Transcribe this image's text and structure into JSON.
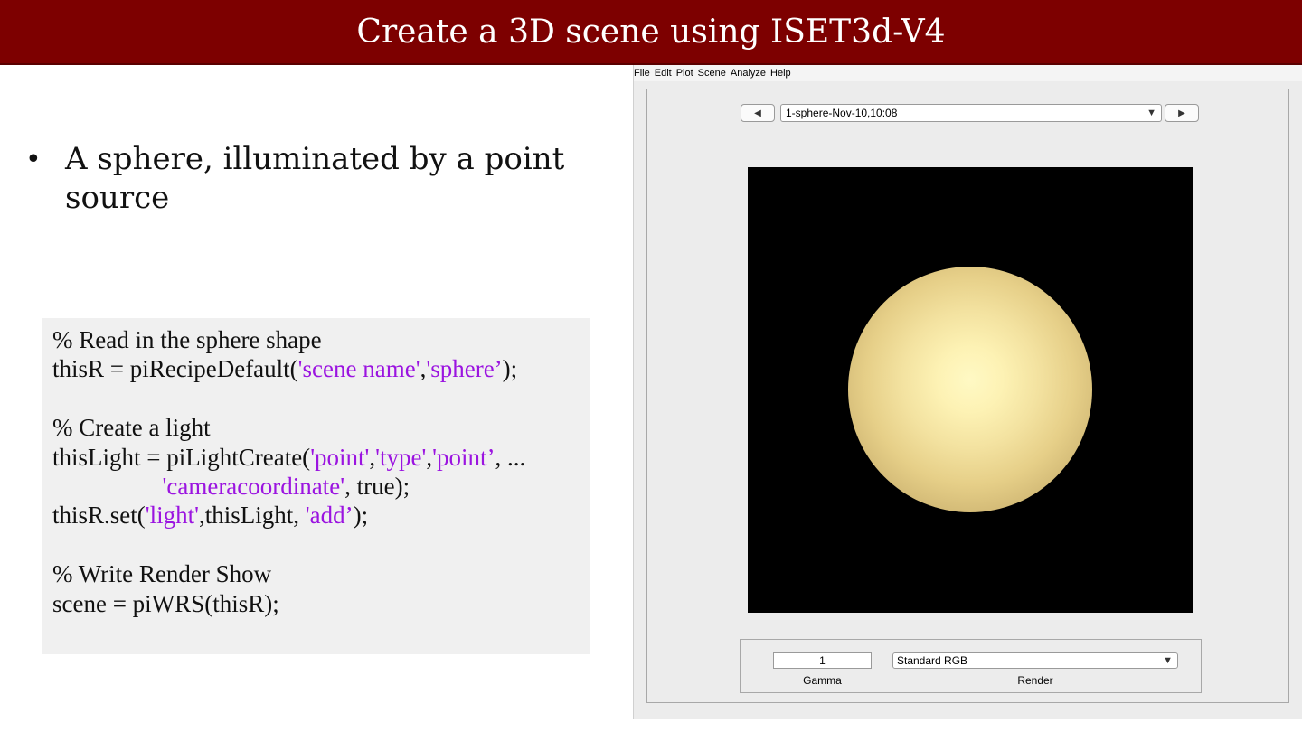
{
  "slide": {
    "title": "Create a 3D scene using ISET3d-V4",
    "bullet_symbol": "•",
    "bullet_line1": "A sphere, illuminated by a point",
    "bullet_line2": "source"
  },
  "code": {
    "l1": "% Read in the sphere shape",
    "l2a": "thisR = piRecipeDefault(",
    "l2b": "'scene name'",
    "l2c": ",",
    "l2d": "'sphere’",
    "l2e": ");",
    "l3": "% Create a light",
    "l4a": "thisLight = piLightCreate(",
    "l4b": "'point'",
    "l4c": ",",
    "l4d": "'type'",
    "l4e": ",",
    "l4f": "'point’",
    "l4g": ", ...",
    "l5a": "                  ",
    "l5b": "'cameracoordinate'",
    "l5c": ", true);",
    "l6a": "thisR.set(",
    "l6b": "'light'",
    "l6c": ",thisLight, ",
    "l6d": "'add’",
    "l6e": ");",
    "l7": "% Write Render Show",
    "l8": "scene = piWRS(thisR);"
  },
  "figure": {
    "menu": [
      "File",
      "Edit",
      "Plot",
      "Scene",
      "Analyze",
      "Help"
    ],
    "prev_icon": "◀",
    "next_icon": "▶",
    "scene_selected": "1-sphere-Nov-10,10:08",
    "dropdown_icon": "▼",
    "gamma_value": "1",
    "gamma_label": "Gamma",
    "render_selected": "Standard RGB",
    "render_label": "Render"
  },
  "colors": {
    "title_bar": "#7d0000",
    "string_literal": "#9b14e0",
    "code_background": "#f0f0f0"
  }
}
